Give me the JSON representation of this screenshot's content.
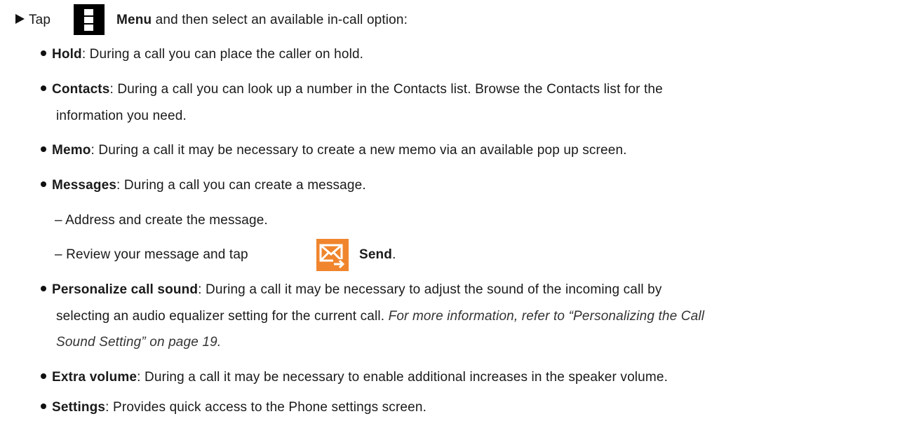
{
  "intro": {
    "pre": "Tap",
    "menu": "Menu",
    "post": " and then select an available in-call option:"
  },
  "icons": {
    "menu": "menu-icon",
    "send": "send-icon"
  },
  "colors": {
    "send_icon_bg": "#f0852d"
  },
  "hold": {
    "term": "Hold",
    "text": ": During a call you can place the caller on hold."
  },
  "contacts": {
    "term": "Contacts",
    "text1": ": During a call you can look up a number in the Contacts list. Browse the Contacts list for the",
    "text2": "information you need."
  },
  "memo": {
    "term": "Memo",
    "text": ": During a call it may be necessary to create a new memo via an available pop up screen."
  },
  "messages": {
    "term": "Messages",
    "text": ": During a call you can create a message.",
    "sub1": "– Address and create the message.",
    "sub2_pre": "– Review your message and tap",
    "sub2_send": "Send",
    "sub2_post": "."
  },
  "personalize": {
    "term": "Personalize call sound",
    "text1": ": During a call it may be necessary to adjust the sound of the incoming call by",
    "text2": "selecting an audio equalizer setting for the current call. ",
    "ref1": "For more information, refer to “Personalizing the Call",
    "ref2": "Sound Setting” on page 19."
  },
  "extra": {
    "term": "Extra volume",
    "text": ": During a call it may be necessary to enable additional increases in the speaker volume."
  },
  "settings": {
    "term": "Settings",
    "text": ": Provides quick access to the Phone settings screen."
  }
}
